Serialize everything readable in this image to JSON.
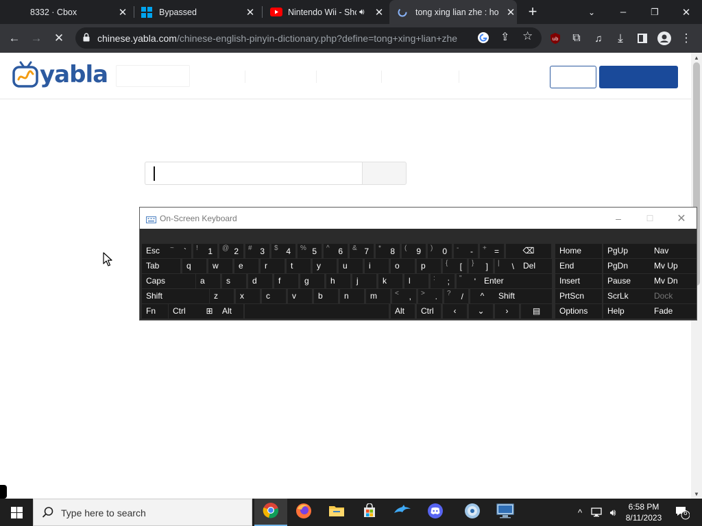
{
  "browser": {
    "tabs": [
      {
        "title": "8332 · Cbox",
        "favicon": "none"
      },
      {
        "title": "Bypassed",
        "favicon": "windows-logo-icon"
      },
      {
        "title": "Nintendo Wii - Sho",
        "favicon": "youtube-icon"
      },
      {
        "title": "tong xing lian zhe : hon",
        "favicon": "loading-icon",
        "active": true
      }
    ],
    "new_tab_label": "+",
    "address": {
      "host": "chinese.yabla.com",
      "path": "/chinese-english-pinyin-dictionary.php?define=tong+xing+lian+zhe"
    }
  },
  "site": {
    "logo_text": "yabla",
    "brand_color": "#2c5aa0"
  },
  "osk": {
    "title": "On-Screen Keyboard",
    "rows": [
      [
        {
          "label": "Esc"
        },
        {
          "shift": "~",
          "main": "`"
        },
        {
          "shift": "!",
          "main": "1"
        },
        {
          "shift": "@",
          "main": "2"
        },
        {
          "shift": "#",
          "main": "3"
        },
        {
          "shift": "$",
          "main": "4"
        },
        {
          "shift": "%",
          "main": "5"
        },
        {
          "shift": "^",
          "main": "6"
        },
        {
          "shift": "&",
          "main": "7"
        },
        {
          "shift": "*",
          "main": "8"
        },
        {
          "shift": "(",
          "main": "9"
        },
        {
          "shift": ")",
          "main": "0"
        },
        {
          "shift": "-",
          "main": "-"
        },
        {
          "shift": "+",
          "main": "="
        },
        {
          "label": "⌫"
        },
        {
          "label": "Home"
        },
        {
          "label": "PgUp"
        },
        {
          "label": "Nav"
        }
      ],
      [
        {
          "label": "Tab"
        },
        {
          "label": "q"
        },
        {
          "label": "w"
        },
        {
          "label": "e"
        },
        {
          "label": "r"
        },
        {
          "label": "t"
        },
        {
          "label": "y"
        },
        {
          "label": "u"
        },
        {
          "label": "i"
        },
        {
          "label": "o"
        },
        {
          "label": "p"
        },
        {
          "shift": "{",
          "main": "["
        },
        {
          "shift": "}",
          "main": "]"
        },
        {
          "shift": "|",
          "main": "\\"
        },
        {
          "label": "Del"
        },
        {
          "label": "End"
        },
        {
          "label": "PgDn"
        },
        {
          "label": "Mv Up"
        }
      ],
      [
        {
          "label": "Caps"
        },
        {
          "label": "a"
        },
        {
          "label": "s"
        },
        {
          "label": "d"
        },
        {
          "label": "f"
        },
        {
          "label": "g"
        },
        {
          "label": "h"
        },
        {
          "label": "j"
        },
        {
          "label": "k"
        },
        {
          "label": "l"
        },
        {
          "shift": ":",
          "main": ";"
        },
        {
          "shift": "\"",
          "main": "'"
        },
        {
          "label": "Enter"
        },
        {
          "label": "Insert"
        },
        {
          "label": "Pause"
        },
        {
          "label": "Mv Dn"
        }
      ],
      [
        {
          "label": "Shift"
        },
        {
          "label": "z"
        },
        {
          "label": "x"
        },
        {
          "label": "c"
        },
        {
          "label": "v"
        },
        {
          "label": "b"
        },
        {
          "label": "n"
        },
        {
          "label": "m"
        },
        {
          "shift": "<",
          "main": ","
        },
        {
          "shift": ">",
          "main": "."
        },
        {
          "shift": "?",
          "main": "/"
        },
        {
          "label": "^"
        },
        {
          "label": "Shift"
        },
        {
          "label": "PrtScn"
        },
        {
          "label": "ScrLk"
        },
        {
          "label": "Dock"
        }
      ],
      [
        {
          "label": "Fn"
        },
        {
          "label": "Ctrl"
        },
        {
          "label": "⊞"
        },
        {
          "label": "Alt"
        },
        {
          "label": ""
        },
        {
          "label": "Alt"
        },
        {
          "label": "Ctrl"
        },
        {
          "label": "‹"
        },
        {
          "label": "⌄"
        },
        {
          "label": "›"
        },
        {
          "label": "▤"
        },
        {
          "label": "Options"
        },
        {
          "label": "Help"
        },
        {
          "label": "Fade"
        }
      ]
    ]
  },
  "taskbar": {
    "search_placeholder": "Type here to search",
    "apps": [
      "chrome-icon",
      "firefox-icon",
      "file-explorer-icon",
      "microsoft-store-icon",
      "dolphin-icon",
      "discord-icon",
      "media-player-icon",
      "remote-desktop-icon"
    ],
    "time": "6:58 PM",
    "date": "8/11/2023",
    "notification_count": "6"
  }
}
